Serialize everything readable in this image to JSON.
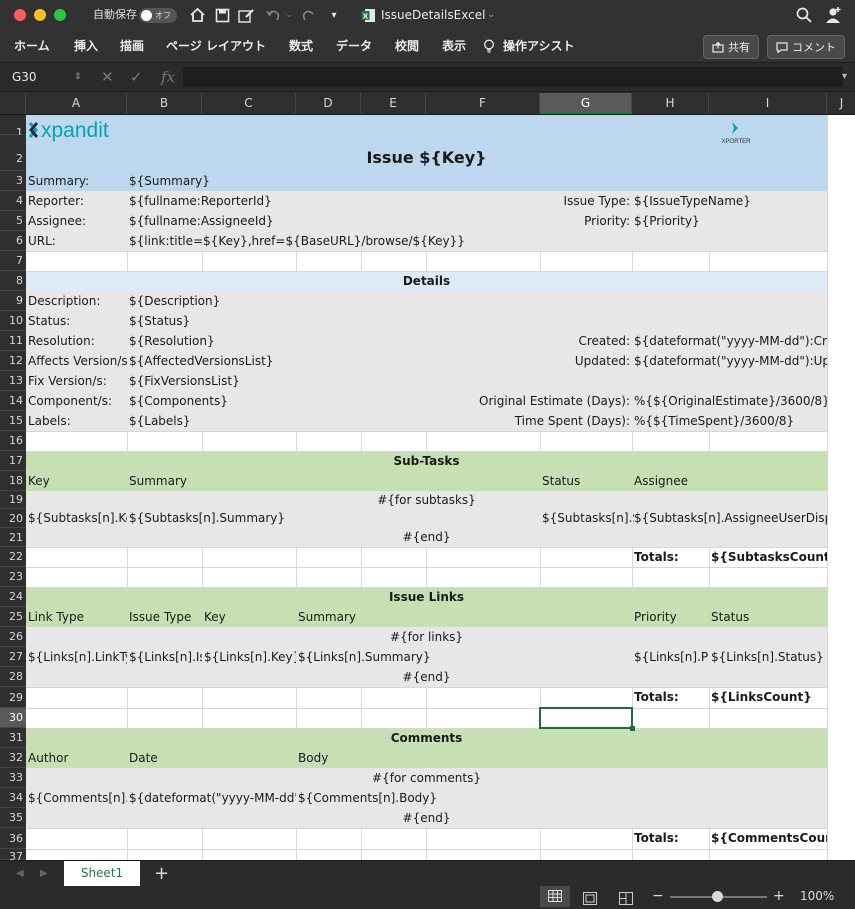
{
  "titlebar": {
    "autosave_label": "自動保存",
    "autosave_state": "オフ",
    "document_title": "IssueDetailsExcel"
  },
  "ribbon": {
    "tabs": [
      "ホーム",
      "挿入",
      "描画",
      "ページ レイアウト",
      "数式",
      "データ",
      "校閲",
      "表示"
    ],
    "assist_label": "操作アシスト",
    "share_label": "共有",
    "comment_label": "コメント"
  },
  "formula": {
    "name_box": "G30",
    "fx": "fx",
    "value": ""
  },
  "columns": [
    "A",
    "B",
    "C",
    "D",
    "E",
    "F",
    "G",
    "H",
    "I",
    "J"
  ],
  "selected_column": "G",
  "rows": [
    "1",
    "2",
    "3",
    "4",
    "5",
    "6",
    "7",
    "8",
    "9",
    "10",
    "11",
    "12",
    "13",
    "14",
    "15",
    "16",
    "17",
    "18",
    "19",
    "20",
    "21",
    "22",
    "23",
    "24",
    "25",
    "26",
    "27",
    "28",
    "29",
    "30",
    "31",
    "32",
    "33",
    "34",
    "35",
    "36",
    "37"
  ],
  "selected_row": "30",
  "logo": {
    "brand": "xpandit",
    "product": "XPORTER",
    "brand_color": "#00a3b4"
  },
  "colors": {
    "header_blue": "#bdd7ee",
    "section_light_blue": "#ddebf7",
    "section_green": "#c6e0b4",
    "gray": "#e7e7e7",
    "excel_green": "#1f7a3a"
  },
  "sheet": {
    "title": "Issue ${Key}",
    "summary_label": "Summary:",
    "summary_value": "${Summary}",
    "reporter_label": "Reporter:",
    "reporter_value": "${fullname:ReporterId}",
    "issuetype_label": "Issue Type:",
    "issuetype_value": "${IssueTypeName}",
    "assignee_label": "Assignee:",
    "assignee_value": "${fullname:AssigneeId}",
    "priority_label": "Priority:",
    "priority_value": "${Priority}",
    "url_label": "URL:",
    "url_value": "${link:title=${Key},href=${BaseURL}/browse/${Key}}",
    "details_header": "Details",
    "description_label": "Description:",
    "description_value": "${Description}",
    "status_label": "Status:",
    "status_value": "${Status}",
    "resolution_label": "Resolution:",
    "resolution_value": "${Resolution}",
    "created_label": "Created:",
    "created_value": "${dateformat(\"yyyy-MM-dd\"):Crea",
    "affects_label": "Affects Version/s:",
    "affects_value": "${AffectedVersionsList}",
    "updated_label": "Updated:",
    "updated_value": "${dateformat(\"yyyy-MM-dd\"):Upda",
    "fixversion_label": "Fix Version/s:",
    "fixversion_value": "${FixVersionsList}",
    "component_label": "Component/s:",
    "component_value": "${Components}",
    "origest_label": "Original Estimate (Days):",
    "origest_value": "%{${OriginalEstimate}/3600/8}",
    "labels_label": "Labels:",
    "labels_value": "${Labels}",
    "timespent_label": "Time Spent (Days):",
    "timespent_value": "%{${TimeSpent}/3600/8}",
    "subtasks_header": "Sub-Tasks",
    "st_key": "Key",
    "st_summary": "Summary",
    "st_status": "Status",
    "st_assignee": "Assignee",
    "st_for": "#{for subtasks}",
    "st_row_key": "${Subtasks[n].Ke",
    "st_row_summary": "${Subtasks[n].Summary}",
    "st_row_status": "${Subtasks[n].S",
    "st_row_assignee": "${Subtasks[n].AssigneeUserDispla",
    "st_end": "#{end}",
    "st_totals_label": "Totals:",
    "st_totals_value": "${SubtasksCount}",
    "links_header": "Issue Links",
    "lk_linktype": "Link Type",
    "lk_issuetype": "Issue Type",
    "lk_key": "Key",
    "lk_summary": "Summary",
    "lk_priority": "Priority",
    "lk_status": "Status",
    "lk_for": "#{for links}",
    "lk_row_linktype": "${Links[n].LinkTy",
    "lk_row_issuetype": "${Links[n].Is",
    "lk_row_key": "${Links[n].Key}",
    "lk_row_summary": "${Links[n].Summary}",
    "lk_row_priority": "${Links[n].Pr",
    "lk_row_status": "${Links[n].Status}",
    "lk_end": "#{end}",
    "lk_totals_label": "Totals:",
    "lk_totals_value": "${LinksCount}",
    "comments_header": "Comments",
    "cm_author": "Author",
    "cm_date": "Date",
    "cm_body": "Body",
    "cm_for": "#{for comments}",
    "cm_row_author": "${Comments[n].A",
    "cm_row_date": "${dateformat(\"yyyy-MM-dd\"):",
    "cm_row_body": "${Comments[n].Body}",
    "cm_end": "#{end}",
    "cm_totals_label": "Totals:",
    "cm_totals_value": "${CommentsCount}"
  },
  "sheetbar": {
    "active_sheet": "Sheet1",
    "add_label": "+"
  },
  "statusbar": {
    "zoom": "100%",
    "zoom_level": 1.0
  }
}
